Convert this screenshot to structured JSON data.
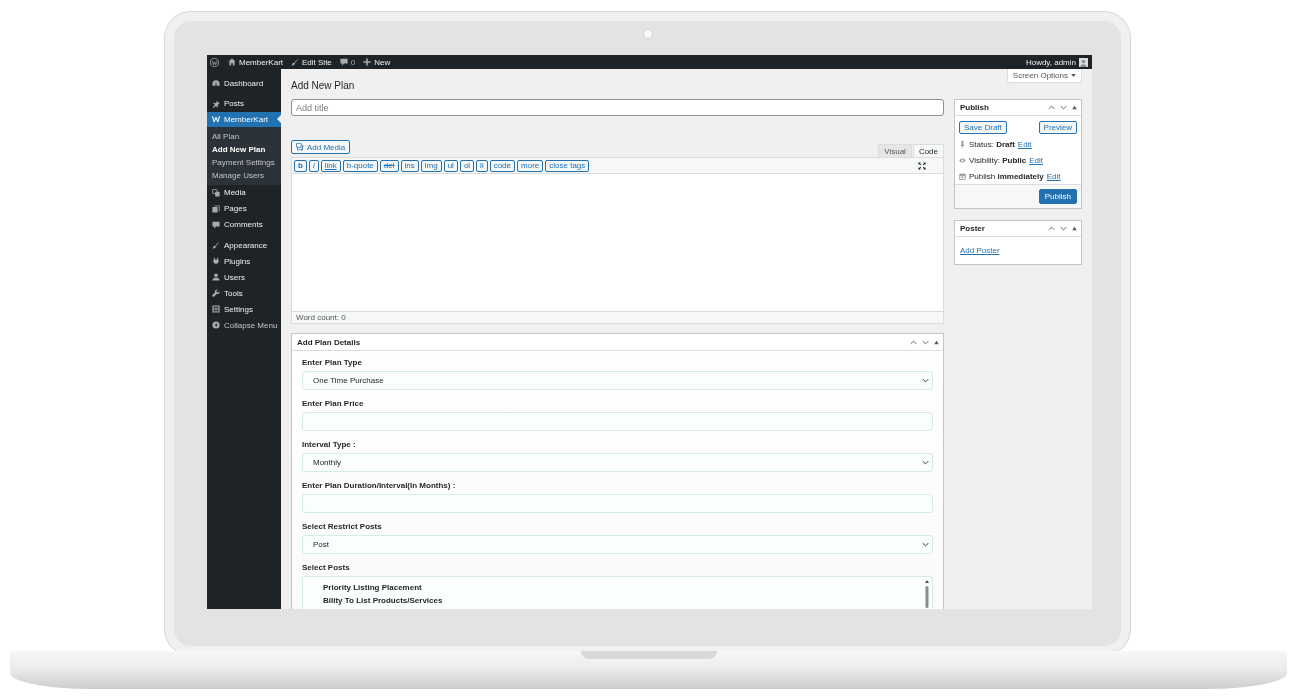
{
  "admin_bar": {
    "site_name": "MemberKart",
    "edit_site": "Edit Site",
    "comments": "0",
    "new": "New",
    "greeting": "Howdy, admin"
  },
  "sidebar": {
    "groups": [
      {
        "items": [
          {
            "label": "Dashboard",
            "selected": false
          }
        ]
      },
      {
        "items": [
          {
            "label": "Posts",
            "selected": false
          },
          {
            "label": "MemberKart",
            "selected": true,
            "expanded": true,
            "children": [
              {
                "label": "All Plan",
                "selected": false
              },
              {
                "label": "Add New Plan",
                "selected": true
              },
              {
                "label": "Payment Settings",
                "selected": false
              },
              {
                "label": "Manage Users",
                "selected": false
              }
            ]
          },
          {
            "label": "Media",
            "selected": false
          },
          {
            "label": "Pages",
            "selected": false
          },
          {
            "label": "Comments",
            "selected": false
          }
        ]
      },
      {
        "items": [
          {
            "label": "Appearance",
            "selected": false
          },
          {
            "label": "Plugins",
            "selected": false
          },
          {
            "label": "Users",
            "selected": false
          },
          {
            "label": "Tools",
            "selected": false
          },
          {
            "label": "Settings",
            "selected": false
          }
        ]
      }
    ],
    "collapse_menu": "Collapse Menu"
  },
  "screen_options": "Screen Options",
  "page": {
    "title": "Add New Plan",
    "title_field": {
      "placeholder": "Add title"
    }
  },
  "editor": {
    "add_media": "Add Media",
    "tabs": [
      {
        "label": "Visual",
        "selected": false
      },
      {
        "label": "Code",
        "selected": true
      }
    ],
    "quicktags": [
      {
        "label": "b",
        "kind": "bold"
      },
      {
        "label": "i",
        "kind": "italic"
      },
      {
        "label": "link",
        "kind": "link"
      },
      {
        "label": "b-quote",
        "kind": "plain"
      },
      {
        "label": "del",
        "kind": "strike"
      },
      {
        "label": "ins",
        "kind": "plain"
      },
      {
        "label": "img",
        "kind": "plain"
      },
      {
        "label": "ul",
        "kind": "plain"
      },
      {
        "label": "ol",
        "kind": "plain"
      },
      {
        "label": "li",
        "kind": "plain"
      },
      {
        "label": "code",
        "kind": "plain"
      },
      {
        "label": "more",
        "kind": "plain"
      },
      {
        "label": "close tags",
        "kind": "plain"
      }
    ],
    "word_count": "Word count: 0"
  },
  "plan_details": {
    "title": "Add Plan Details",
    "fields": [
      {
        "label": "Enter Plan Type",
        "kind": "select",
        "value": "One Time Purchase"
      },
      {
        "label": "Enter Plan Price",
        "kind": "text"
      },
      {
        "label": "Interval Type :",
        "kind": "select",
        "value": "Monthly"
      },
      {
        "label": "Enter Plan Duration/Interval(In Months) :",
        "kind": "text"
      },
      {
        "label": "Select Restrict Posts",
        "kind": "select",
        "value": "Post"
      },
      {
        "label": "Select Posts",
        "kind": "multiselect",
        "options": [
          "Priority Listing Placement",
          "Bility To List Products/Services"
        ]
      }
    ]
  },
  "publish": {
    "title": "Publish",
    "save_draft": "Save Draft",
    "preview": "Preview",
    "meta": [
      {
        "text": "Status: **Draft**",
        "link": "Edit"
      },
      {
        "text": "Visibility: **Public**",
        "link": "Edit"
      },
      {
        "text": "Publish **immediately**",
        "link": "Edit"
      }
    ],
    "publish_button": "Publish"
  },
  "poster": {
    "title": "Poster",
    "link": "Add Poster"
  }
}
